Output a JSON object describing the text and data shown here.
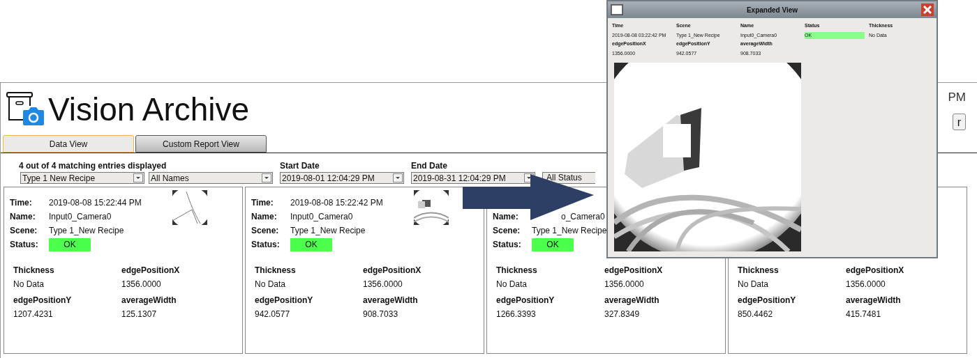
{
  "header": {
    "title": "Vision Archive",
    "clock": "PM",
    "button": "r"
  },
  "tabs": [
    {
      "label": "Data View",
      "selected": true
    },
    {
      "label": "Custom Report View",
      "selected": false
    }
  ],
  "filters": {
    "summary": "4 out of 4 matching entries displayed",
    "scene": "Type 1  New Recipe",
    "name": "All Names",
    "start_label": "Start Date",
    "start": "2019-08-01 12:04:29 PM",
    "end_label": "End Date",
    "end": "2019-08-31 12:04:29 PM",
    "status": "All Status"
  },
  "cards": [
    {
      "thumbnail": true,
      "rows": [
        {
          "kind": "text",
          "label": "Time:",
          "value": "2019-08-08  15:22:44 PM"
        },
        {
          "kind": "text",
          "label": "Name:",
          "value": "Input0_Camera0"
        },
        {
          "kind": "text",
          "label": "Scene:",
          "value": "Type 1_New Recipe"
        },
        {
          "kind": "status",
          "label": "Status:",
          "value": "OK"
        }
      ],
      "metrics": [
        {
          "label": "Thickness",
          "value": "No Data"
        },
        {
          "label": "edgePositionX",
          "value": "1356.0000"
        },
        {
          "label": "edgePositionY",
          "value": "1207.4231"
        },
        {
          "label": "averageWidth",
          "value": "125.1307"
        }
      ]
    },
    {
      "thumbnail": true,
      "rows": [
        {
          "kind": "text",
          "label": "Time:",
          "value": "2019-08-08  15:22:42 PM"
        },
        {
          "kind": "text",
          "label": "Name:",
          "value": "Input0_Camera0"
        },
        {
          "kind": "text",
          "label": "Scene:",
          "value": "Type 1_New Recipe"
        },
        {
          "kind": "status",
          "label": "Status:",
          "value": "OK"
        }
      ],
      "metrics": [
        {
          "label": "Thickness",
          "value": "No Data"
        },
        {
          "label": "edgePositionX",
          "value": "1356.0000"
        },
        {
          "label": "edgePositionY",
          "value": "942.0577"
        },
        {
          "label": "averageWidth",
          "value": "908.7033"
        }
      ]
    },
    {
      "thumbnail": false,
      "rows": [
        {
          "kind": "covered"
        },
        {
          "kind": "partial",
          "label": "Name:",
          "value": "o_Camera0"
        },
        {
          "kind": "text",
          "label": "Scene:",
          "value": "Type 1_New Recipe"
        },
        {
          "kind": "status",
          "label": "Status:",
          "value": "OK"
        }
      ],
      "metrics": [
        {
          "label": "Thickness",
          "value": "No Data"
        },
        {
          "label": "edgePositionX",
          "value": "1356.0000"
        },
        {
          "label": "edgePositionY",
          "value": "1266.3393"
        },
        {
          "label": "averageWidth",
          "value": "327.8349"
        }
      ]
    },
    {
      "thumbnail": false,
      "metrics": [
        {
          "label": "Thickness",
          "value": "No Data"
        },
        {
          "label": "edgePositionX",
          "value": "1356.0000"
        },
        {
          "label": "edgePositionY",
          "value": "850.4462"
        },
        {
          "label": "averageWidth",
          "value": "415.7481"
        }
      ]
    }
  ],
  "expanded_view": {
    "title": "Expanded View",
    "fields": [
      {
        "kind": "text",
        "label": "Time",
        "value": "2019-08-08 03:22:42 PM"
      },
      {
        "kind": "text",
        "label": "Scene",
        "value": "Type 1_New Recipe"
      },
      {
        "kind": "text",
        "label": "Name",
        "value": "Input0_Camera0"
      },
      {
        "kind": "status",
        "label": "Status",
        "value": "OK"
      },
      {
        "kind": "text",
        "label": "Thickness",
        "value": "No Data"
      },
      {
        "kind": "text",
        "label": "edgePositionX",
        "value": "1356.0000"
      },
      {
        "kind": "text",
        "label": "edgePositionY",
        "value": "942.0577"
      },
      {
        "kind": "text",
        "label": "averageWidth",
        "value": "908.7033"
      }
    ]
  }
}
